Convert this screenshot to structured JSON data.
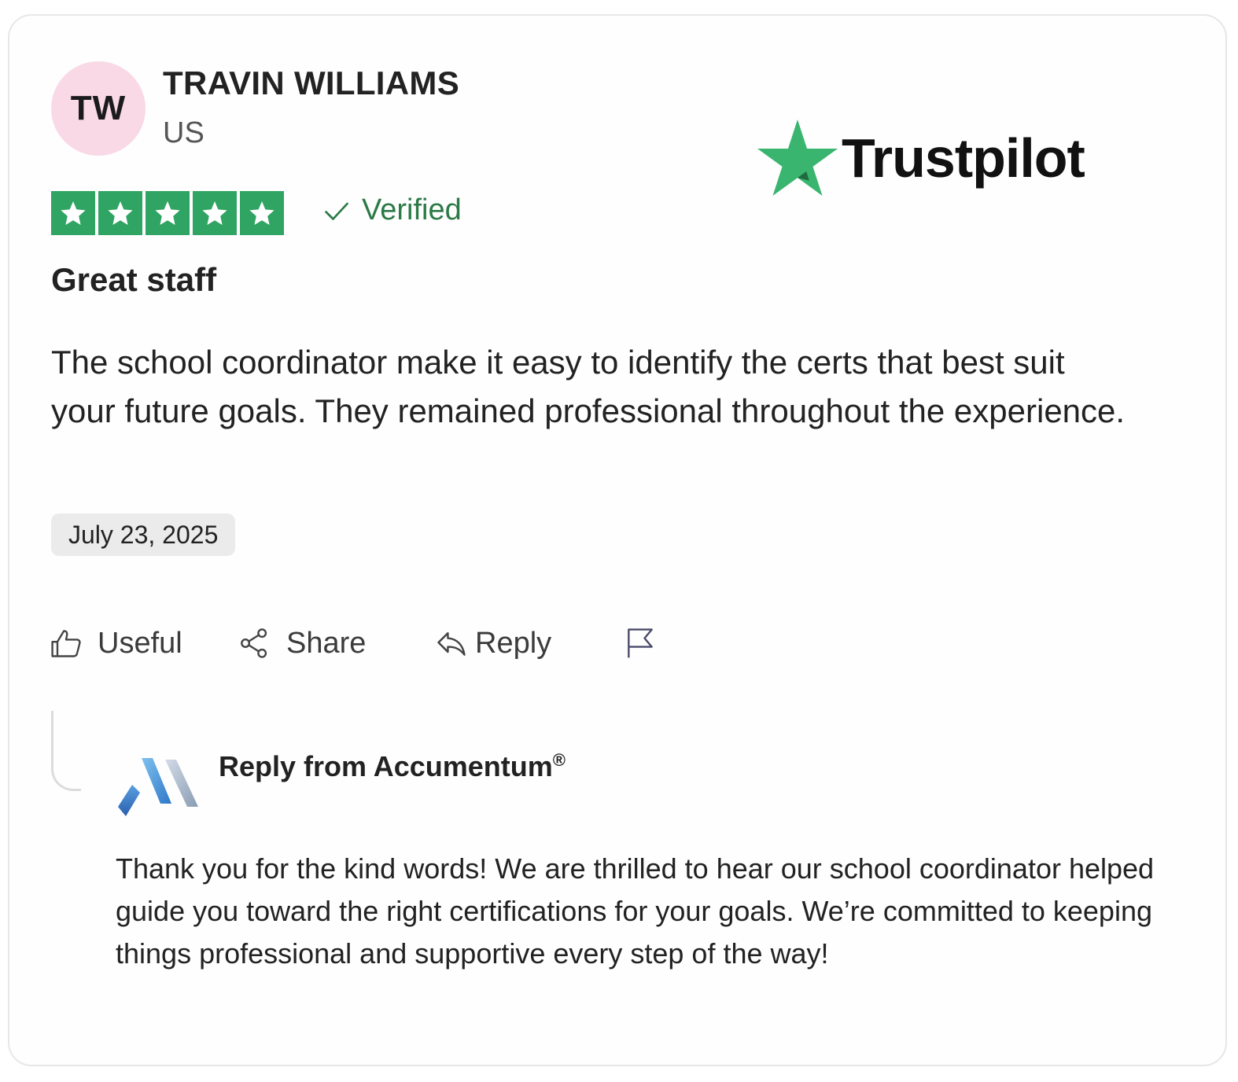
{
  "reviewer": {
    "initials": "TW",
    "name": "TRAVIN WILLIAMS",
    "country": "US"
  },
  "brand": {
    "name": "Trustpilot",
    "color": "#3ab56f"
  },
  "rating": {
    "stars": 5,
    "max": 5,
    "color": "#2fa463"
  },
  "verified_label": "Verified",
  "review": {
    "title": "Great staff",
    "body": "The school coordinator make it easy to identify the certs that best suit your future goals. They remained professional throughout the experience.",
    "date": "July 23, 2025"
  },
  "actions": {
    "useful": "Useful",
    "share": "Share",
    "reply": "Reply"
  },
  "company_reply": {
    "heading": "Reply from Accumentum",
    "trademark": "®",
    "body": "Thank you for the kind words! We are thrilled to hear our school coordinator helped guide you toward the right certifications for your goals. We’re committed to keeping things professional and supportive every step of the way!"
  }
}
